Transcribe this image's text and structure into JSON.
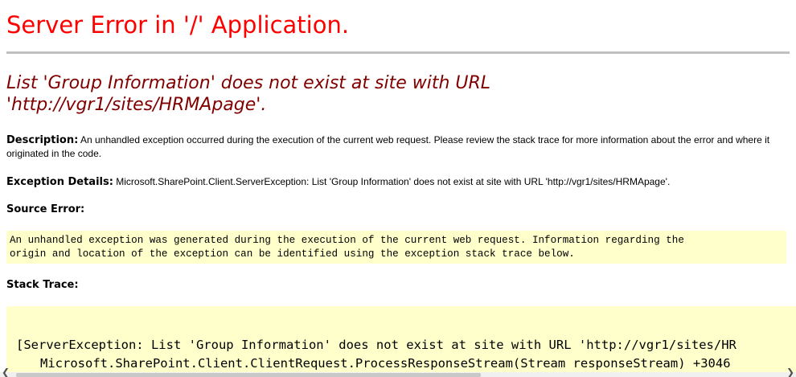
{
  "page": {
    "title": "Server Error in '/' Application.",
    "error_message": "List 'Group Information' does not exist at site with URL 'http://vgr1/sites/HRMApage'."
  },
  "description": {
    "label": "Description:",
    "text": " An unhandled exception occurred during the execution of the current web request. Please review the stack trace for more information about the error and where it originated in the code."
  },
  "exception_details": {
    "label": "Exception Details:",
    "text": " Microsoft.SharePoint.Client.ServerException: List 'Group Information' does not exist at site with URL 'http://vgr1/sites/HRMApage'."
  },
  "source_error": {
    "label": "Source Error:",
    "text": "An unhandled exception was generated during the execution of the current web request. Information regarding the\norigin and location of the exception can be identified using the exception stack trace below."
  },
  "stack_trace": {
    "label": "Stack Trace:",
    "lines": [
      "[ServerException: List 'Group Information' does not exist at site with URL 'http://vgr1/sites/HR",
      "Microsoft.SharePoint.Client.ClientRequest.ProcessResponseStream(Stream responseStream) +3046"
    ]
  },
  "colors": {
    "title": "#ff0000",
    "error_message": "#800000",
    "code_background": "#ffffcc",
    "rule": "#c0c0c0"
  },
  "icons": {
    "scroll_left": "chevron-left-icon",
    "scroll_right": "chevron-right-icon"
  }
}
